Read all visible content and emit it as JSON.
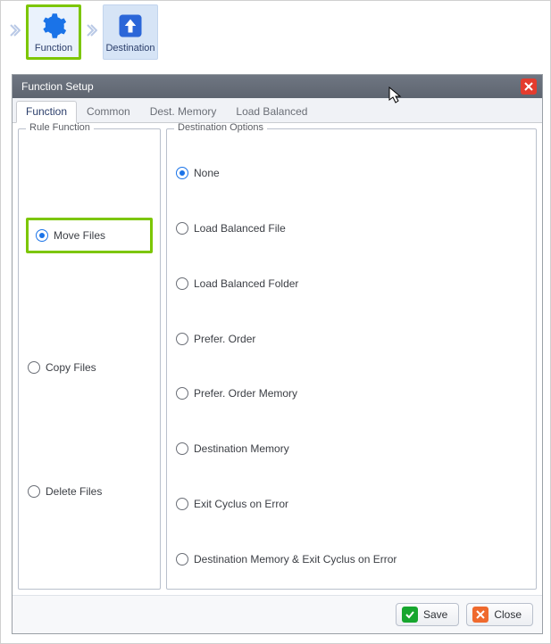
{
  "toolbar": {
    "function_label": "Function",
    "destination_label": "Destination"
  },
  "dialog": {
    "title": "Function Setup",
    "tabs": {
      "function": "Function",
      "common": "Common",
      "dest_memory": "Dest. Memory",
      "load_balanced": "Load Balanced"
    },
    "rule_function": {
      "legend": "Rule Function",
      "options": {
        "move": "Move Files",
        "copy": "Copy Files",
        "delete": "Delete Files"
      },
      "selected": "move"
    },
    "destination_options": {
      "legend": "Destination Options",
      "options": {
        "none": "None",
        "lb_file": "Load Balanced File",
        "lb_folder": "Load Balanced Folder",
        "prefer_order": "Prefer. Order",
        "prefer_order_mem": "Prefer. Order Memory",
        "dest_memory": "Destination Memory",
        "exit_cyclus": "Exit Cyclus on Error",
        "dest_mem_exit": "Destination Memory & Exit Cyclus on Error"
      },
      "selected": "none"
    },
    "buttons": {
      "save": "Save",
      "close": "Close"
    }
  }
}
